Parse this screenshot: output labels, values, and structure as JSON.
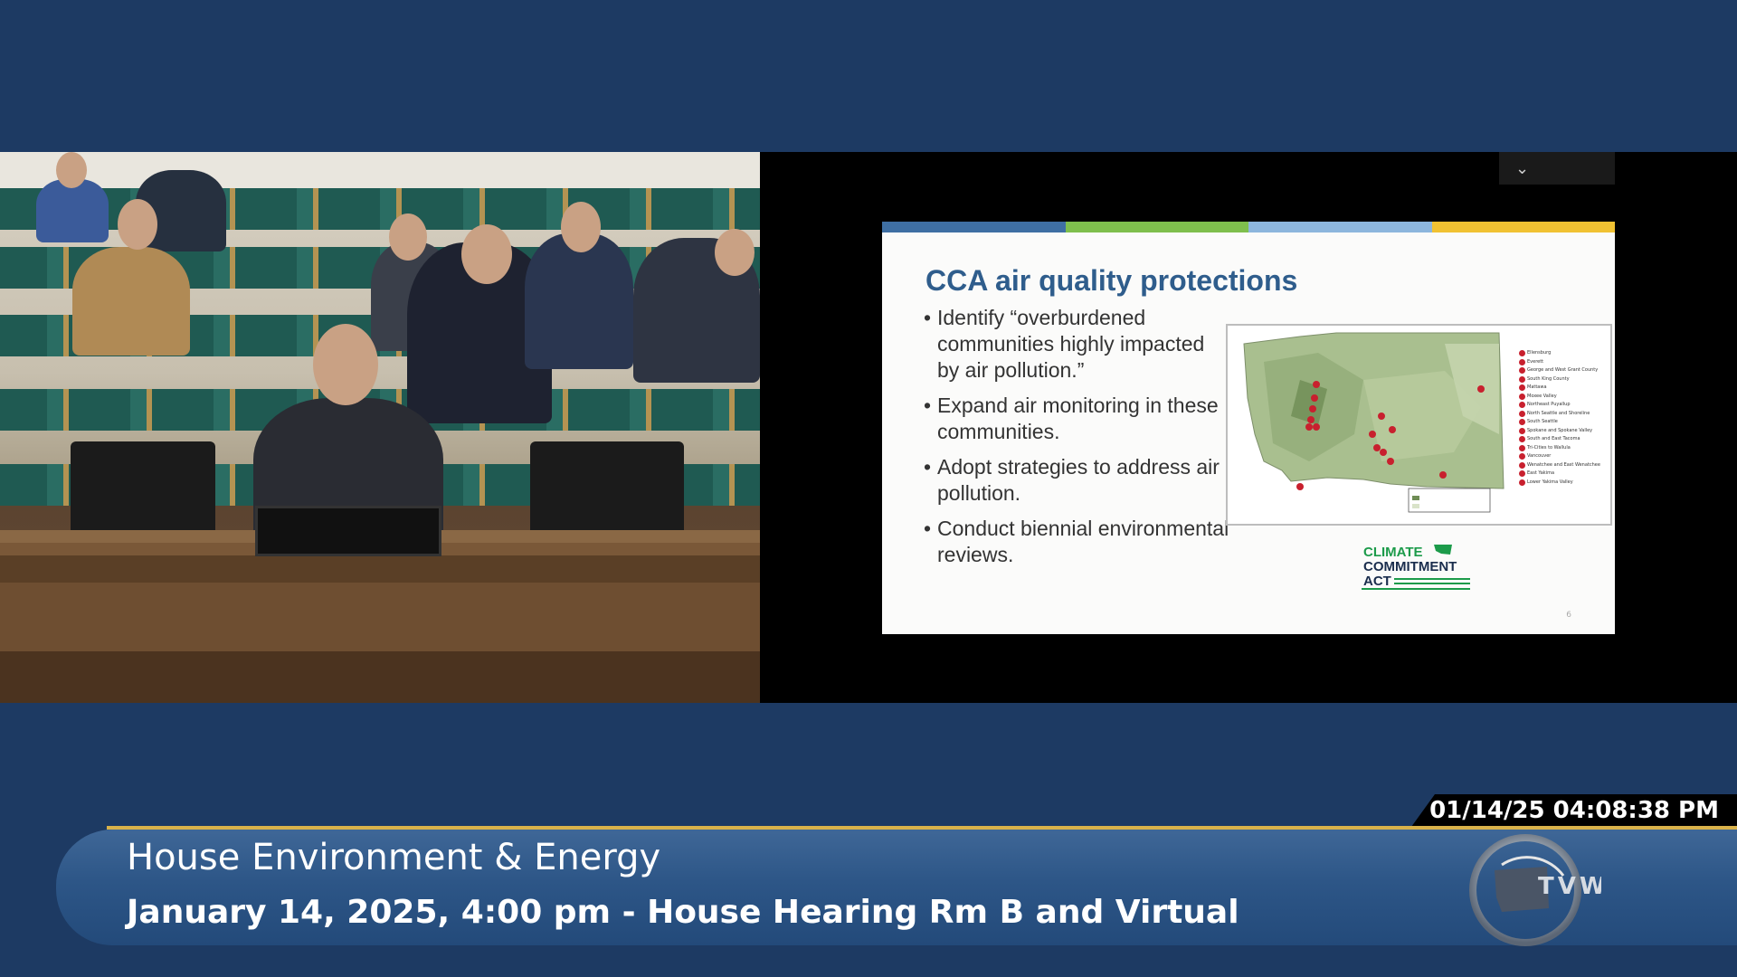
{
  "slide": {
    "title": "CCA air quality protections",
    "bullets": [
      "Identify “overburdened communities highly impacted by air pollution.”",
      "Expand air monitoring in these communities.",
      "Adopt strategies to address air pollution.",
      "Conduct biennial environmental reviews."
    ],
    "bar_colors": [
      "#3f6fa3",
      "#7fbf4d",
      "#8db6dd",
      "#f1c232"
    ],
    "map_legend": [
      "Ellensburg",
      "Everett",
      "George and West Grant County",
      "South King County",
      "Mattawa",
      "Moxee Valley",
      "Northeast Puyallup",
      "North Seattle and Shoreline",
      "South Seattle",
      "Spokane and Spokane Valley",
      "South and East Tacoma",
      "Tri-Cities to Wallula",
      "Vancouver",
      "Wenatchee and East Wenatchee",
      "East Yakima",
      "Lower Yakima Valley"
    ],
    "logo": {
      "line1": "CLIMATE",
      "line2": "COMMITMENT",
      "line3": "ACT"
    },
    "page_number": "6"
  },
  "controls": {
    "dropdown_icon": "chevron-down-icon",
    "dropdown_glyph": "⌄"
  },
  "broadcast": {
    "timestamp": "01/14/25 04:08:38 PM",
    "title": "House Environment & Energy",
    "subtitle": "January 14, 2025, 4:00 pm - House Hearing Rm B and Virtual",
    "network_logo": "TVW"
  }
}
